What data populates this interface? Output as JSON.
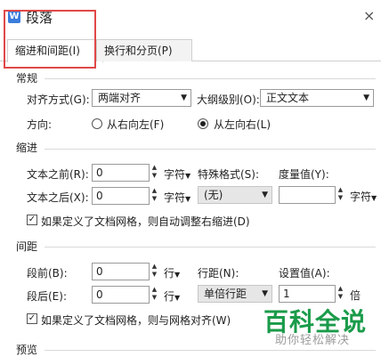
{
  "window": {
    "title": "段落",
    "icon_glyph": "W",
    "close_glyph": "×"
  },
  "tabs": [
    {
      "label": "缩进和间距(I)"
    },
    {
      "label": "换行和分页(P)"
    }
  ],
  "general": {
    "heading": "常规",
    "align_label": "对齐方式(G):",
    "align_value": "两端对齐",
    "outline_label": "大纲级别(O):",
    "outline_value": "正文文本",
    "direction_label": "方向:",
    "rtl_label": "从右向左(F)",
    "ltr_label": "从左向右(L)",
    "direction_selected": "从左向右(L)"
  },
  "indent": {
    "heading": "缩进",
    "before_label": "文本之前(R):",
    "before_value": "0",
    "before_unit": "字符",
    "after_label": "文本之后(X):",
    "after_value": "0",
    "after_unit": "字符",
    "special_label": "特殊格式(S):",
    "special_value": "(无)",
    "measure_label": "度量值(Y):",
    "measure_value": "",
    "measure_unit": "字符",
    "grid_check_label": "如果定义了文档网格，则自动调整右缩进(D)",
    "grid_checked": true
  },
  "spacing": {
    "heading": "间距",
    "before_label": "段前(B):",
    "before_value": "0",
    "before_unit": "行",
    "after_label": "段后(E):",
    "after_value": "0",
    "after_unit": "行",
    "line_label": "行距(N):",
    "line_value": "单倍行距",
    "setting_label": "设置值(A):",
    "setting_value": "1",
    "setting_unit": "倍",
    "grid_check_label": "如果定义了文档网格，则与网格对齐(W)",
    "grid_checked": true
  },
  "preview": {
    "heading": "预览"
  },
  "watermark": {
    "title": "百科全说",
    "subtitle": "助你轻松解决"
  },
  "colors": {
    "highlight_box": "#e04848",
    "watermark_green": "#1a9b4a"
  }
}
